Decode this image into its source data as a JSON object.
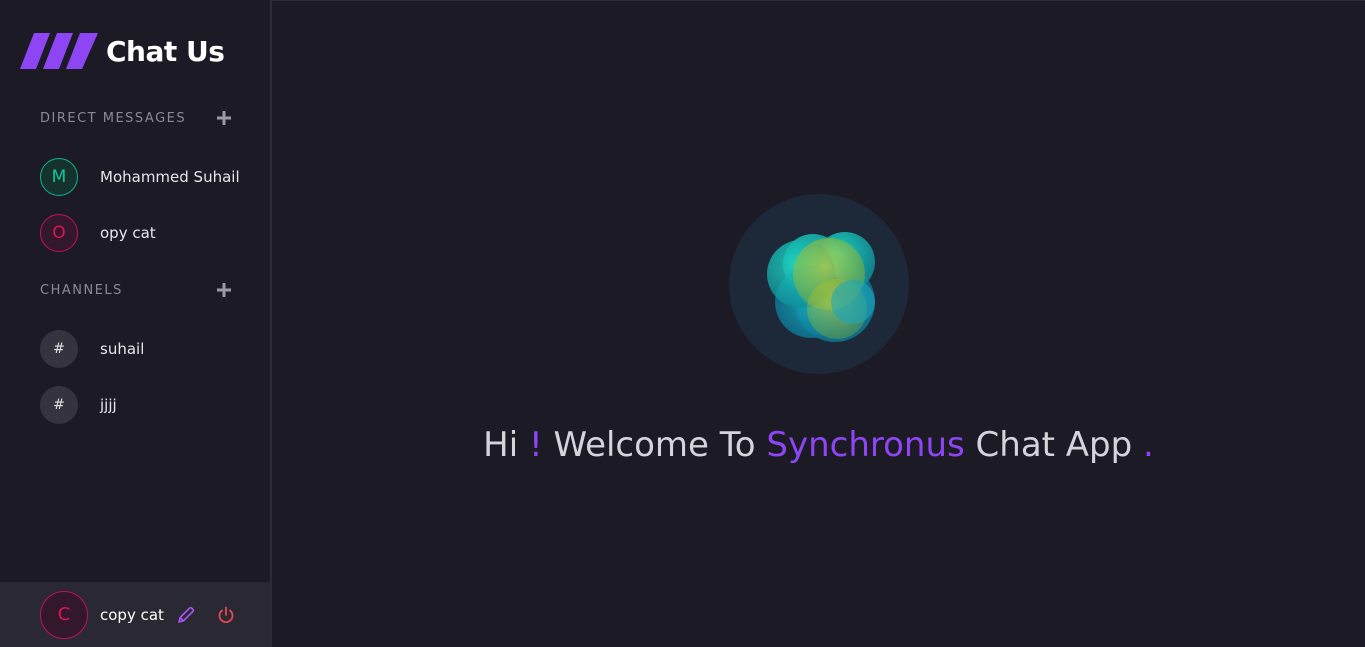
{
  "app": {
    "title": "Chat Us",
    "accent_color": "#8e45f4"
  },
  "sidebar": {
    "direct_messages": {
      "title": "DIRECT MESSAGES",
      "add_icon": "plus-icon",
      "items": [
        {
          "initial": "M",
          "name": "Mohammed Suhail",
          "color": "#12c79b"
        },
        {
          "initial": "O",
          "name": "opy cat",
          "color": "#e0125a"
        }
      ]
    },
    "channels": {
      "title": "CHANNELS",
      "add_icon": "plus-icon",
      "items": [
        {
          "symbol": "#",
          "name": "suhail"
        },
        {
          "symbol": "#",
          "name": "jjjj"
        }
      ]
    }
  },
  "profile": {
    "initial": "C",
    "name": "copy cat",
    "edit_icon": "pencil-icon",
    "logout_icon": "power-icon"
  },
  "welcome": {
    "greeting": "Hi",
    "exclaim": "!",
    "text": "Welcome To",
    "app_name": "Synchronus",
    "suffix": "Chat App",
    "period": "."
  }
}
